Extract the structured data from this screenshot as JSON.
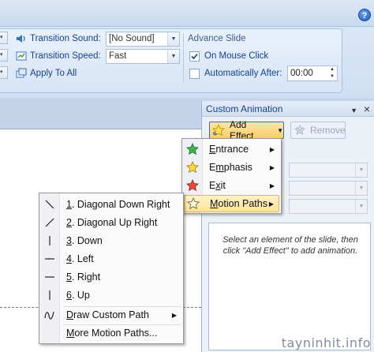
{
  "ribbon": {
    "transition_sound_label": "Transition Sound:",
    "transition_sound_value": "[No Sound]",
    "transition_speed_label": "Transition Speed:",
    "transition_speed_value": "Fast",
    "apply_to_all_label": "Apply To All",
    "advance_slide_title": "Advance Slide",
    "on_mouse_click_label": "On Mouse Click",
    "on_mouse_click_checked": true,
    "automatically_after_label": "Automatically After:",
    "automatically_after_checked": false,
    "time_value": "00:00",
    "help_label": "?"
  },
  "pane": {
    "title": "Custom Animation",
    "add_effect_label": "Add Effect",
    "remove_label": "Remove",
    "hint": "Select an element of the slide, then click \"Add Effect\" to add animation."
  },
  "effect_menu": {
    "items": [
      {
        "key": "E",
        "rest": "ntrance",
        "icon": "entrance-star-icon"
      },
      {
        "key": "m",
        "pre": "E",
        "rest": "phasis",
        "icon": "emphasis-star-icon"
      },
      {
        "key": "x",
        "pre": "E",
        "rest": "it",
        "icon": "exit-star-icon"
      },
      {
        "key": "M",
        "rest": "otion Paths",
        "icon": "motion-path-star-icon"
      }
    ]
  },
  "paths_menu": {
    "items": [
      {
        "num": "1",
        "rest": ". Diagonal Down Right"
      },
      {
        "num": "2",
        "rest": ". Diagonal Up Right"
      },
      {
        "num": "3",
        "rest": ". Down"
      },
      {
        "num": "4",
        "rest": ". Left"
      },
      {
        "num": "5",
        "rest": ". Right"
      },
      {
        "num": "6",
        "rest": ". Up"
      }
    ],
    "draw_custom_key": "D",
    "draw_custom_rest": "raw Custom Path",
    "more_key": "M",
    "more_rest": "ore Motion Paths..."
  },
  "watermark": "tayninhit.info"
}
